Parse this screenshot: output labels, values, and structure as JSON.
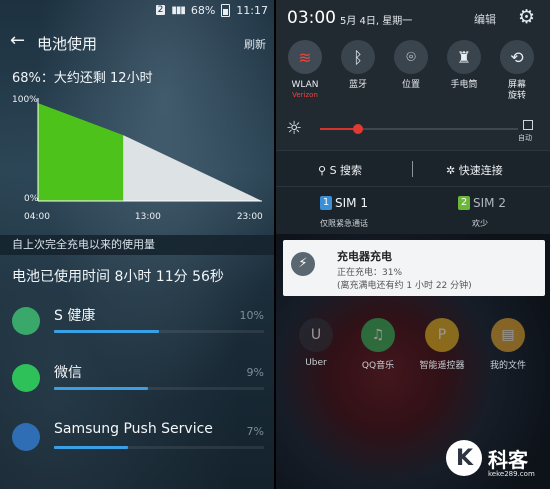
{
  "left": {
    "status": {
      "sim": "2",
      "battery": "68%",
      "time": "11:17"
    },
    "appbar": {
      "title": "电池使用",
      "refresh": "刷新"
    },
    "remaining": "68%：大约还剩 12小时",
    "section": "自上次完全充电以来的使用量",
    "used_time": "电池已使用时间 8小时 11分 56秒",
    "apps": [
      {
        "name": "S 健康",
        "percent": "10%",
        "usage": 0.1,
        "icon": "s-health-icon",
        "color": "#3aa86a"
      },
      {
        "name": "微信",
        "percent": "9%",
        "usage": 0.09,
        "icon": "wechat-icon",
        "color": "#2ec15a"
      },
      {
        "name": "Samsung Push Service",
        "percent": "7%",
        "usage": 0.07,
        "icon": "samsung-push-icon",
        "color": "#2f6db5"
      }
    ]
  },
  "chart_data": {
    "type": "area",
    "x_ticks": [
      "04:00",
      "13:00",
      "23:00"
    ],
    "y_ticks": [
      "100%",
      "0%"
    ],
    "ylim": [
      0,
      100
    ],
    "series": [
      {
        "segment": "used",
        "x": [
          0,
          0.38
        ],
        "y": [
          95,
          64
        ],
        "color": "#4cc21a"
      },
      {
        "segment": "predicted",
        "x": [
          0.38,
          1.0
        ],
        "y": [
          64,
          0
        ],
        "color": "#dde2e5"
      }
    ],
    "colors": {
      "used": "#4cc21a",
      "predicted": "#dde2e5"
    }
  },
  "right": {
    "time": "03:00",
    "date": "5月 4日, 星期一",
    "edit": "编辑",
    "tiles": [
      {
        "label": "WLAN",
        "sub": "Verizon",
        "icon": "wifi-icon",
        "on": true
      },
      {
        "label": "蓝牙",
        "sub": "",
        "icon": "bluetooth-icon",
        "on": false
      },
      {
        "label": "位置",
        "sub": "",
        "icon": "location-icon",
        "on": false
      },
      {
        "label": "手电筒",
        "sub": "",
        "icon": "flashlight-icon",
        "on": false
      },
      {
        "label": "屏幕\n旋转",
        "sub": "",
        "icon": "rotate-icon",
        "on": false
      }
    ],
    "brightness": {
      "level": 0.19,
      "auto": "自动"
    },
    "search": "S 搜索",
    "quick_connect": "快速连接",
    "sims": [
      {
        "chip": "1",
        "name": "SIM 1",
        "sub": "仅限紧急通话",
        "color": "#3a8fd8"
      },
      {
        "chip": "2",
        "name": "SIM 2",
        "sub": "欢少",
        "color": "#6cb63a"
      }
    ],
    "notification": {
      "title": "充电器充电",
      "line1": "正在充电：31%",
      "line2": "(离充满电还有约 1 小时 22 分钟)"
    },
    "dock": [
      {
        "label": "Uber",
        "icon": "uber-icon",
        "color": "#2a2f36",
        "glyph": "U"
      },
      {
        "label": "QQ音乐",
        "icon": "qq-music-icon",
        "color": "#27b45a",
        "glyph": "♫"
      },
      {
        "label": "智能遥控器",
        "icon": "remote-icon",
        "color": "#d9b21f",
        "glyph": "P"
      },
      {
        "label": "我的文件",
        "icon": "files-icon",
        "color": "#e2a22a",
        "glyph": "▤"
      }
    ],
    "brand": {
      "name": "科客",
      "url": "keke289.com"
    }
  }
}
